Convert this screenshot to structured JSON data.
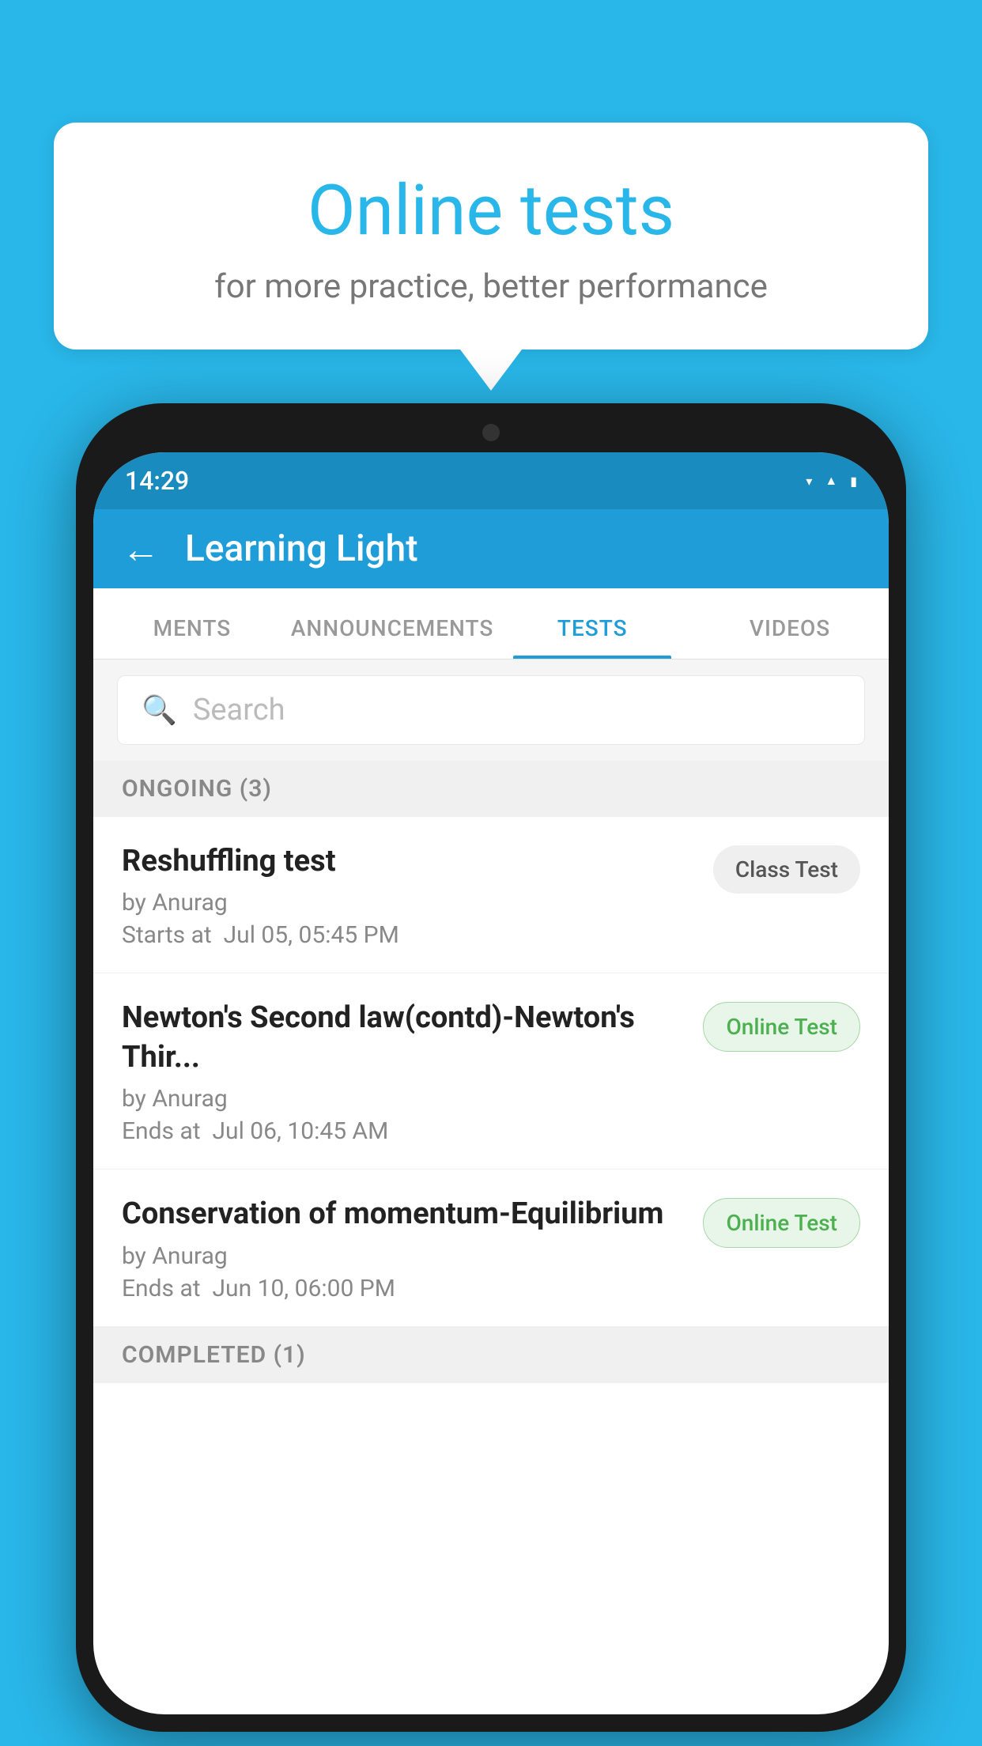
{
  "background": {
    "color": "#29b6e8"
  },
  "speech_bubble": {
    "title": "Online tests",
    "subtitle": "for more practice, better performance"
  },
  "phone": {
    "status_bar": {
      "time": "14:29"
    },
    "app_header": {
      "title": "Learning Light",
      "back_label": "←"
    },
    "tabs": [
      {
        "label": "MENTS",
        "active": false
      },
      {
        "label": "ANNOUNCEMENTS",
        "active": false
      },
      {
        "label": "TESTS",
        "active": true
      },
      {
        "label": "VIDEOS",
        "active": false
      }
    ],
    "search": {
      "placeholder": "Search"
    },
    "ongoing_section": {
      "label": "ONGOING (3)"
    },
    "tests": [
      {
        "name": "Reshuffling test",
        "by": "by Anurag",
        "date": "Starts at  Jul 05, 05:45 PM",
        "badge": "Class Test",
        "badge_type": "class"
      },
      {
        "name": "Newton's Second law(contd)-Newton's Thir...",
        "by": "by Anurag",
        "date": "Ends at  Jul 06, 10:45 AM",
        "badge": "Online Test",
        "badge_type": "online"
      },
      {
        "name": "Conservation of momentum-Equilibrium",
        "by": "by Anurag",
        "date": "Ends at  Jun 10, 06:00 PM",
        "badge": "Online Test",
        "badge_type": "online"
      }
    ],
    "completed_section": {
      "label": "COMPLETED (1)"
    }
  }
}
